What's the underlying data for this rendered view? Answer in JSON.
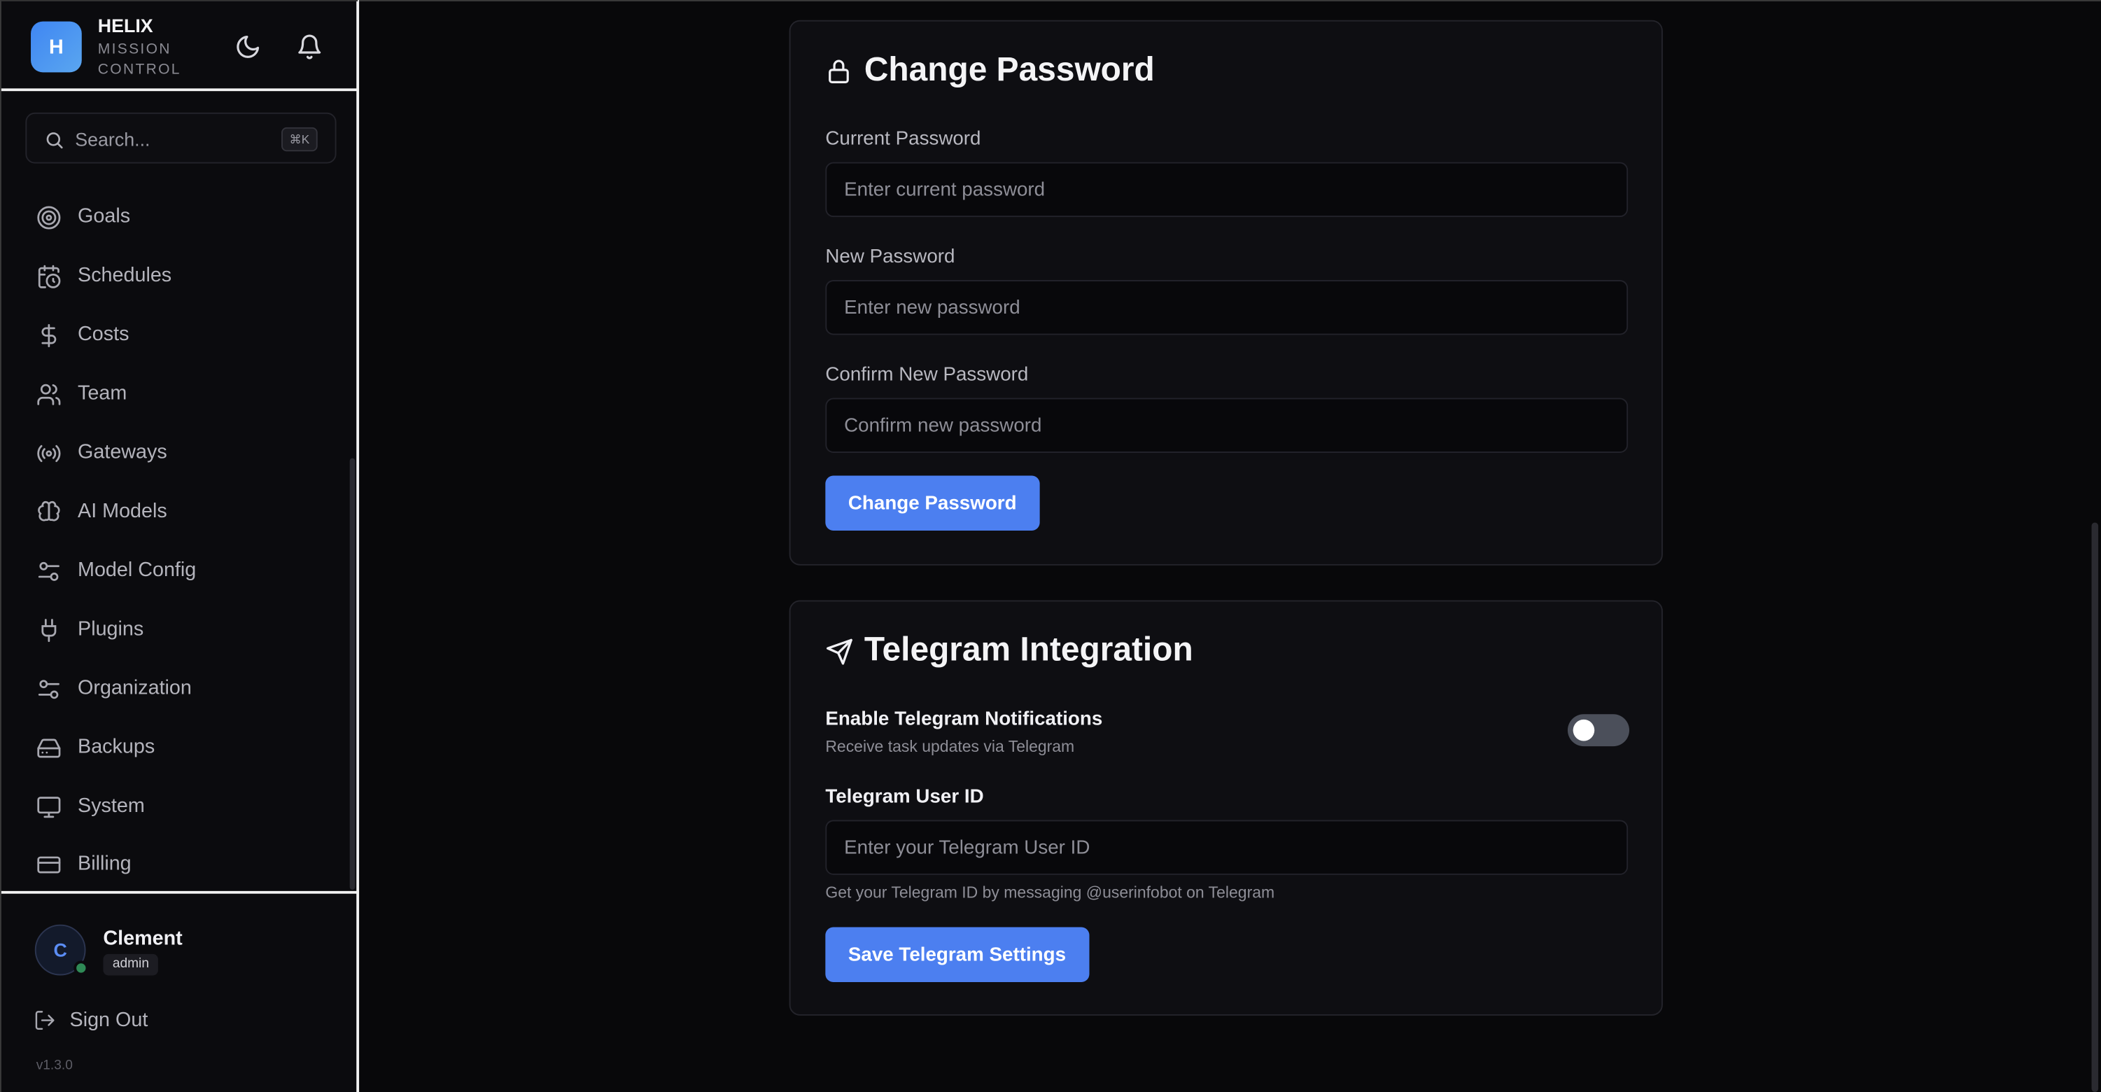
{
  "brand": {
    "logo_letter": "H",
    "name": "HELIX",
    "subtitle": "MISSION CONTROL"
  },
  "header_icons": [
    "moon-icon",
    "bell-icon"
  ],
  "search": {
    "placeholder": "Search...",
    "shortcut": "⌘K"
  },
  "sidebar": {
    "items": [
      {
        "label": "Goals",
        "icon": "target-icon"
      },
      {
        "label": "Schedules",
        "icon": "calendar-clock-icon"
      },
      {
        "label": "Costs",
        "icon": "dollar-icon"
      },
      {
        "label": "Team",
        "icon": "users-icon"
      },
      {
        "label": "Gateways",
        "icon": "radio-icon"
      },
      {
        "label": "AI Models",
        "icon": "brain-icon"
      },
      {
        "label": "Model Config",
        "icon": "sliders-icon"
      },
      {
        "label": "Plugins",
        "icon": "plug-icon"
      },
      {
        "label": "Organization",
        "icon": "sliders-icon"
      },
      {
        "label": "Backups",
        "icon": "hard-drive-icon"
      },
      {
        "label": "System",
        "icon": "monitor-icon"
      },
      {
        "label": "Billing",
        "icon": "credit-card-icon"
      }
    ]
  },
  "user": {
    "initial": "C",
    "name": "Clement",
    "role": "admin",
    "status": "online"
  },
  "signout_label": "Sign Out",
  "version": "v1.3.0",
  "password_card": {
    "title": "Change Password",
    "current_label": "Current Password",
    "current_placeholder": "Enter current password",
    "new_label": "New Password",
    "new_placeholder": "Enter new password",
    "confirm_label": "Confirm New Password",
    "confirm_placeholder": "Confirm new password",
    "button_label": "Change Password"
  },
  "telegram_card": {
    "title": "Telegram Integration",
    "enable_label": "Enable Telegram Notifications",
    "enable_desc": "Receive task updates via Telegram",
    "enabled": false,
    "userid_label": "Telegram User ID",
    "userid_placeholder": "Enter your Telegram User ID",
    "hint": "Get your Telegram ID by messaging @userinfobot on Telegram",
    "button_label": "Save Telegram Settings"
  },
  "colors": {
    "accent": "#4c7ff0",
    "background": "#08080a",
    "card": "#0e0e12",
    "online": "#2f8a56"
  }
}
